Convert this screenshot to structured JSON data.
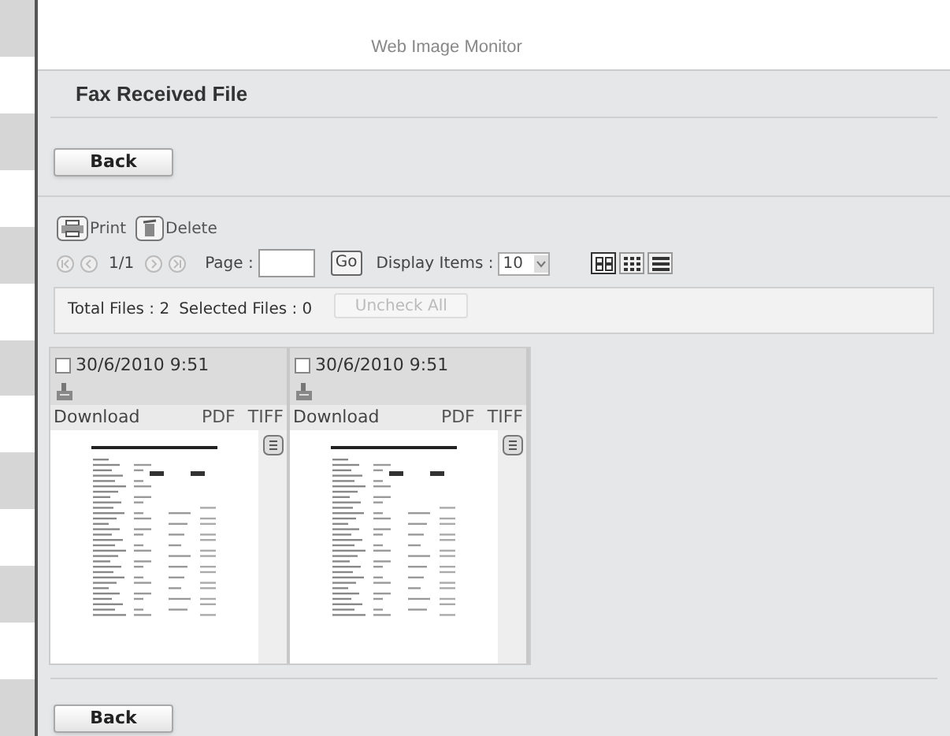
{
  "header": {
    "title": "Web Image Monitor"
  },
  "page_title": "Fax Received File",
  "back_buttons": [
    "Back",
    "Back"
  ],
  "toolbar": [
    {
      "kind": "print",
      "label": "Print"
    },
    {
      "kind": "delete",
      "label": "Delete"
    }
  ],
  "pagination": {
    "page_indicator": "1/1",
    "page_label": "Page :",
    "go": "Go",
    "display_label": "Display Items :",
    "display_value": "10"
  },
  "view_modes": [
    {
      "kind": "large",
      "selected": true
    },
    {
      "kind": "small",
      "selected": false
    },
    {
      "kind": "list",
      "selected": false
    }
  ],
  "summary": {
    "total": "Total Files : 2",
    "selected": "Selected Files : 0",
    "uncheck_all": {
      "label": "Uncheck All",
      "disabled": true
    }
  },
  "files": [
    {
      "date": "30/6/2010 9:51",
      "checked": false,
      "download": "Download",
      "formats": [
        "PDF",
        "TIFF"
      ]
    },
    {
      "date": "30/6/2010 9:51",
      "checked": false,
      "download": "Download",
      "formats": [
        "PDF",
        "TIFF"
      ]
    }
  ]
}
